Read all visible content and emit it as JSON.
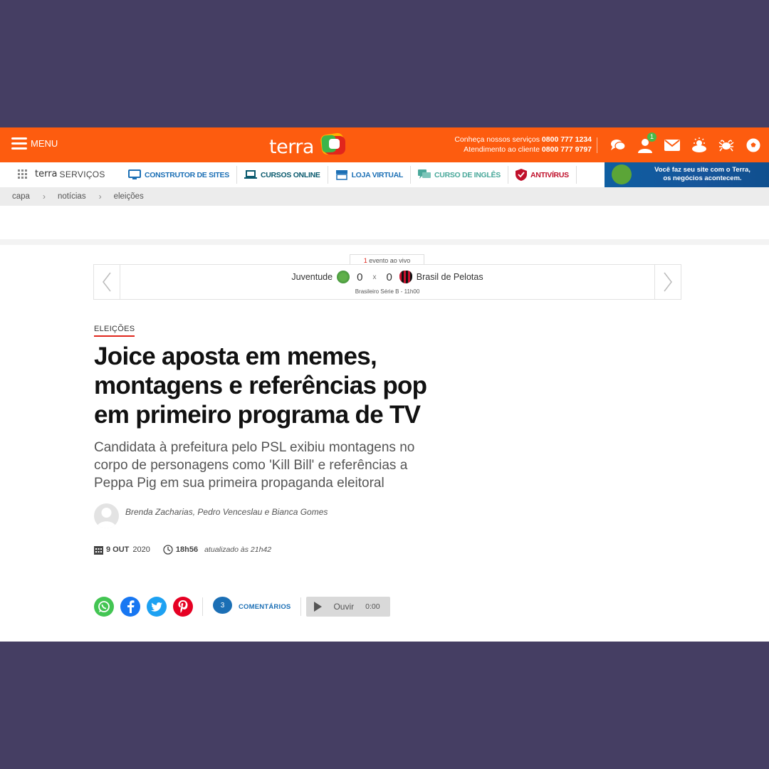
{
  "header": {
    "menu_label": "MENU",
    "logo_text": "terra",
    "contact_line1_prefix": "Conheça nossos serviços",
    "contact_line1_number": "0800 777 1234",
    "contact_line2_prefix": "Atendimento ao cliente",
    "contact_line2_number": "0800 777 9797",
    "notification_count": "1",
    "icons": [
      "chat-icon",
      "user-icon",
      "mail-icon",
      "weather-icon",
      "horoscope-icon",
      "soccer-ball-icon"
    ]
  },
  "services": {
    "brand": "terra",
    "brand_suffix": "SERVIÇOS",
    "links": [
      {
        "label": "CONSTRUTOR DE SITES",
        "color": "#1b6fb5",
        "icon": "monitor-icon"
      },
      {
        "label": "CURSOS ONLINE",
        "color": "#0a5a6e",
        "icon": "laptop-icon"
      },
      {
        "label": "LOJA VIRTUAL",
        "color": "#1b6fb5",
        "icon": "store-icon"
      },
      {
        "label": "CURSO DE INGLÊS",
        "color": "#49a89a",
        "icon": "speech-icon"
      },
      {
        "label": "ANTIVÍRUS",
        "color": "#c0102b",
        "icon": "shield-icon"
      }
    ],
    "promo_line1": "Você faz seu site com o Terra,",
    "promo_line2": "os negócios acontecem."
  },
  "breadcrumb": [
    "capa",
    "notícias",
    "eleições"
  ],
  "live": {
    "count": "1",
    "label": "evento ao vivo",
    "home_team": "Juventude",
    "home_score": "0",
    "separator": "x",
    "away_score": "0",
    "away_team": "Brasil de Pelotas",
    "competition": "Brasileiro Série B - 11h00"
  },
  "article": {
    "section": "ELEIÇÕES",
    "headline": "Joice aposta em memes, montagens e referências pop em primeiro programa de TV",
    "subtitle": "Candidata à prefeitura pelo PSL exibiu montagens no corpo de personagens como 'Kill Bill' e referências a Peppa Pig em sua primeira propaganda eleitoral",
    "authors": "Brenda Zacharias, Pedro Venceslau e Bianca Gomes",
    "date_day": "9 OUT",
    "date_year": "2020",
    "time": "18h56",
    "updated": "atualizado às 21h42"
  },
  "share": {
    "comment_count": "3",
    "comments_label": "COMENTÁRIOS",
    "listen_label": "Ouvir",
    "listen_duration": "0:00"
  },
  "colors": {
    "brand_orange": "#fd5c0f",
    "accent_red": "#e1261c",
    "link_blue": "#1b6fb5",
    "whatsapp": "#43c553",
    "facebook": "#1877f2",
    "twitter": "#1da1f2",
    "pinterest": "#e60023"
  }
}
